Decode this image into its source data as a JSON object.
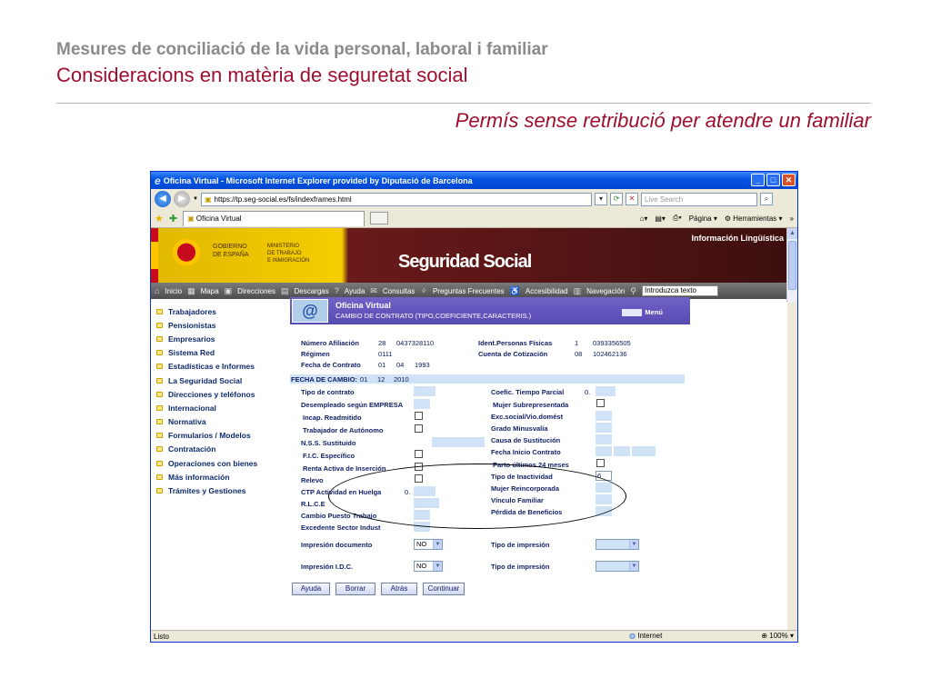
{
  "slide": {
    "title": "Mesures de conciliació de la vida personal, laboral i familiar",
    "subtitle": "Consideracions en matèria de seguretat social",
    "topic": "Permís sense retribució per atendre un familiar"
  },
  "browser": {
    "window_title": "Oficina Virtual - Microsoft Internet Explorer provided by Diputació de Barcelona",
    "url": "https://tp.seg-social.es/fs/indexframes.html",
    "search_placeholder": "Live Search",
    "tab_label": "Oficina Virtual",
    "cmd_pagina": "Página",
    "cmd_herramientas": "Herramientas",
    "status_left": "Listo",
    "status_zone": "Internet",
    "status_zoom": "100%"
  },
  "banner": {
    "gobierno_1": "GOBIERNO",
    "gobierno_2": "DE ESPAÑA",
    "ministerio_1": "MINISTERIO",
    "ministerio_2": "DE TRABAJO",
    "ministerio_3": "E INMIGRACIÓN",
    "title": "Seguridad Social",
    "info": "Información Lingüística"
  },
  "nav": {
    "items": [
      "Inicio",
      "Mapa",
      "Direcciones",
      "Descargas",
      "Ayuda",
      "Consultas",
      "Preguntas Frecuentes",
      "Accesibilidad",
      "Navegación"
    ],
    "search_value": "Introduzca texto"
  },
  "menu": {
    "items": [
      "Trabajadores",
      "Pensionistas",
      "Empresarios",
      "Sistema Red",
      "Estadísticas e Informes",
      "La Seguridad Social",
      "Direcciones y teléfonos",
      "Internacional",
      "Normativa",
      "Formularios / Modelos",
      "Contratación",
      "Operaciones con bienes",
      "Más información",
      "Trámites y Gestiones"
    ]
  },
  "form": {
    "header_title": "Oficina Virtual",
    "header_sub": "CAMBIO DE CONTRATO (TIPO,COEFICIENTE,CARACTERIS.)",
    "header_menu": "Menú",
    "num_afiliacion_label": "Número Afiliación",
    "num_afiliacion_1": "28",
    "num_afiliacion_2": "0437328110",
    "regimen_label": "Régimen",
    "regimen_value": "0111",
    "fecha_contrato_label": "Fecha de Contrato",
    "fecha_contrato_d": "01",
    "fecha_contrato_m": "04",
    "fecha_contrato_y": "1993",
    "ident_label": "Ident.Personas Físicas",
    "ident_1": "1",
    "ident_2": "0393356505",
    "cuenta_label": "Cuenta de Cotización",
    "cuenta_1": "08",
    "cuenta_2": "102462136",
    "fecha_cambio_label": "FECHA DE CAMBIO:",
    "fecha_cambio_d": "01",
    "fecha_cambio_m": "12",
    "fecha_cambio_y": "2010",
    "left_labels": [
      "Tipo de contrato",
      "Desempleado según EMPRESA",
      "Incap. Readmitido",
      "Trabajador de Autónomo",
      "N.S.S. Sustituido",
      "F.I.C. Específico",
      "Renta Activa de Inserción",
      "Relevo",
      "CTP Actividad en Huelga",
      "R.L.C.E",
      "Cambio Puesto Trabajo",
      "Excedente Sector Indust"
    ],
    "ctp_value": "0.",
    "right_labels": [
      "Coefic. Tiempo Parcial",
      "Mujer Subrepresentada",
      "Exc.social/Vio.domést",
      "Grado Minusvalía",
      "Causa de Sustitución",
      "Fecha Inicio Contrato",
      "Parto últimos 24 meses",
      "Tipo de Inactividad",
      "Mujer Reincorporada",
      "Vínculo Familiar",
      "Pérdida de Beneficios"
    ],
    "coefic_value": "0.",
    "tipo_inactividad_value": "6",
    "impresion_doc_label": "Impresión documento",
    "impresion_doc_value": "NO",
    "impresion_idc_label": "Impresión I.D.C.",
    "impresion_idc_value": "NO",
    "tipo_impresion_label": "Tipo de impresión",
    "buttons": [
      "Ayuda",
      "Borrar",
      "Atrás",
      "Continuar"
    ]
  }
}
